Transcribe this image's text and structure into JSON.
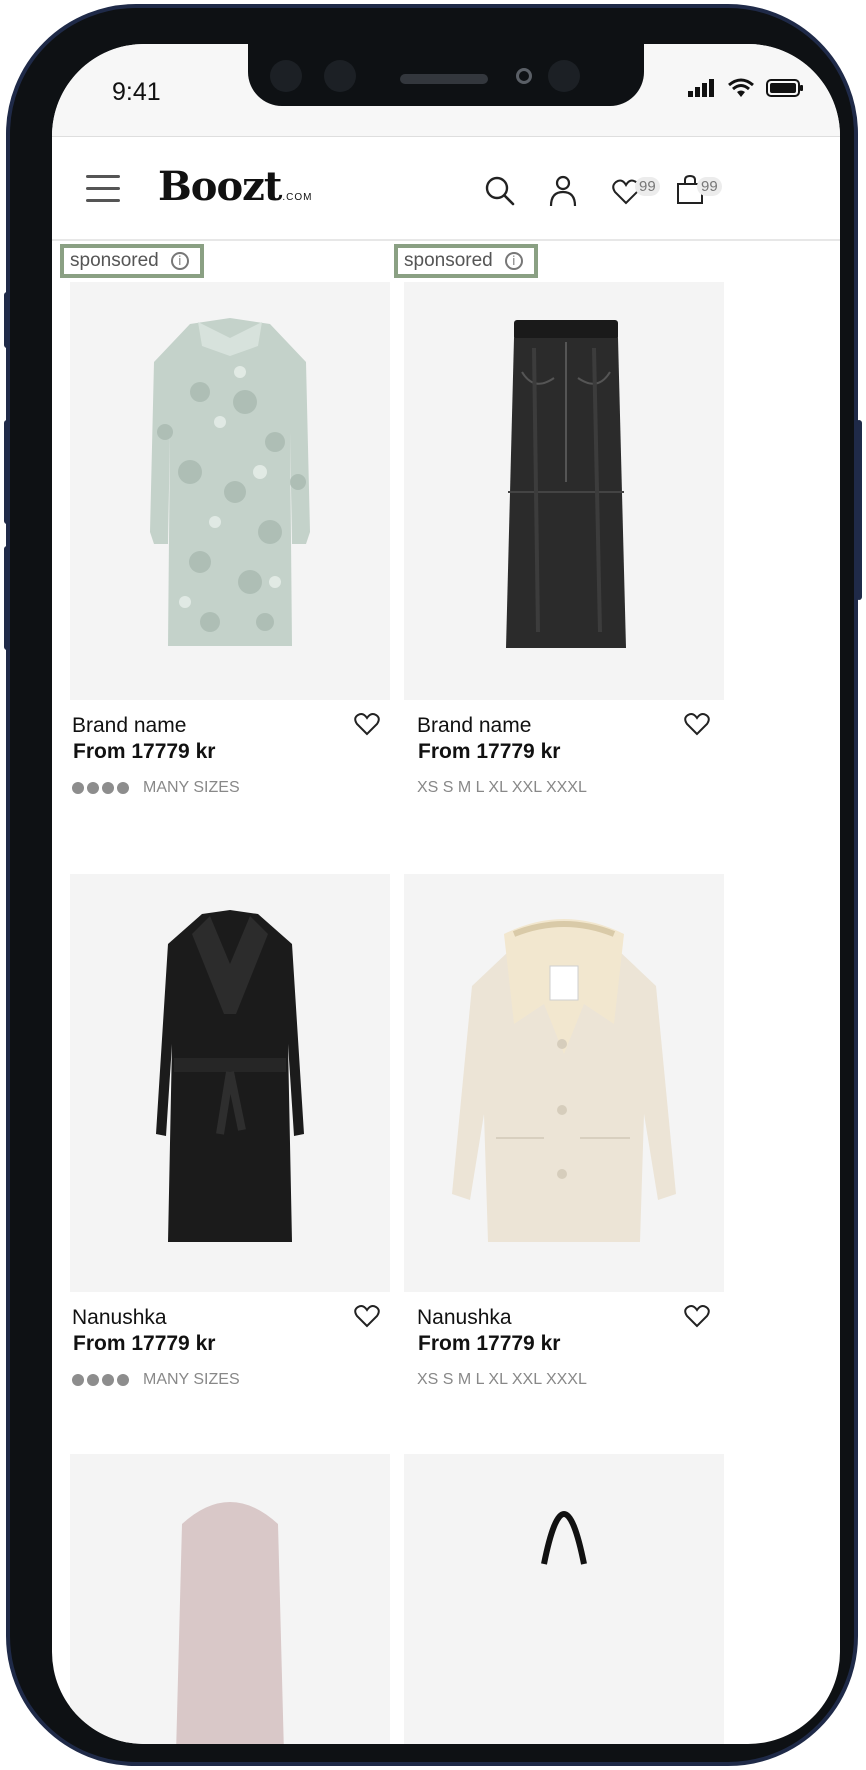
{
  "status_bar": {
    "time": "9:41"
  },
  "header": {
    "logo": "Boozt",
    "logo_suffix": ".COM",
    "wishlist_count": "99",
    "bag_count": "99"
  },
  "products": [
    {
      "sponsored": "sponsored",
      "brand": "Brand name",
      "price": "From 17779 kr",
      "sizes": "MANY SIZES",
      "swatches": true
    },
    {
      "sponsored": "sponsored",
      "brand": "Brand name",
      "price": "From 17779 kr",
      "sizes": "XS S M L XL XXL XXXL",
      "swatches": false
    },
    {
      "brand": "Nanushka",
      "price": "From 17779 kr",
      "sizes": "MANY SIZES",
      "swatches": true
    },
    {
      "brand": "Nanushka",
      "price": "From 17779 kr",
      "sizes": "XS S M L XL XXL XXXL",
      "swatches": false
    }
  ],
  "colors": {
    "sponsored_border": "#8aa083",
    "frame": "#0e1114",
    "image_bg": "#f4f4f4"
  }
}
